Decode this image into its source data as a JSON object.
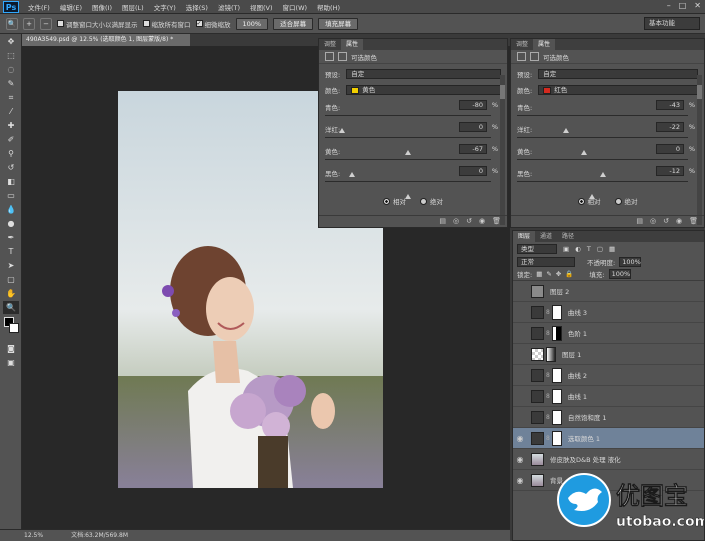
{
  "app": {
    "logo": "Ps"
  },
  "menu": [
    "文件(F)",
    "编辑(E)",
    "图像(I)",
    "图层(L)",
    "文字(Y)",
    "选择(S)",
    "滤镜(T)",
    "视图(V)",
    "窗口(W)",
    "帮助(H)"
  ],
  "window_controls": {
    "min": "–",
    "max": "□",
    "close": "✕"
  },
  "options": {
    "tool_icon": "zoom-icon",
    "resize_windows": "调整窗口大小以满屏显示",
    "zoom_all": "缩放所有窗口",
    "scrubby_zoom": "细微缩放",
    "btn_100": "100%",
    "btn_fit": "适合屏幕",
    "btn_fill": "填充屏幕",
    "workspace": "基本功能"
  },
  "document": {
    "tab": "490A3549.psd @ 12.5% (选取颜色 1, 图层蒙版/8) *",
    "zoom": "12.5%",
    "doc_size": "文档:63.2M/569.8M"
  },
  "props_left": {
    "tabs": [
      "调整",
      "属性"
    ],
    "title": "可选颜色",
    "preset_label": "预设:",
    "preset_value": "自定",
    "color_label": "颜色:",
    "color_value": "黄色",
    "swatch_color": "#f2cf00",
    "sliders": [
      {
        "label": "青色:",
        "value": "-80",
        "unit": "%",
        "pos": -80
      },
      {
        "label": "洋红:",
        "value": "0",
        "unit": "%",
        "pos": 0
      },
      {
        "label": "黄色:",
        "value": "-67",
        "unit": "%",
        "pos": -67
      },
      {
        "label": "黑色:",
        "value": "0",
        "unit": "%",
        "pos": 0
      }
    ],
    "relative": "相对",
    "absolute": "绝对"
  },
  "props_right": {
    "tabs": [
      "调整",
      "属性"
    ],
    "title": "可选颜色",
    "preset_label": "预设:",
    "preset_value": "自定",
    "color_label": "颜色:",
    "color_value": "红色",
    "swatch_color": "#d42a1f",
    "sliders": [
      {
        "label": "青色:",
        "value": "-43",
        "unit": "%",
        "pos": -43
      },
      {
        "label": "洋红:",
        "value": "-22",
        "unit": "%",
        "pos": -22
      },
      {
        "label": "黄色:",
        "value": "0",
        "unit": "%",
        "pos": 0
      },
      {
        "label": "黑色:",
        "value": "-12",
        "unit": "%",
        "pos": -12
      }
    ],
    "relative": "相对",
    "absolute": "绝对"
  },
  "layers": {
    "tabs": [
      "图层",
      "通道",
      "路径"
    ],
    "filter": "类型",
    "blend_mode": "正常",
    "opacity_label": "不透明度:",
    "opacity": "100%",
    "lock_label": "锁定:",
    "fill_label": "填充:",
    "fill": "100%",
    "rows": [
      {
        "name": "图层 2",
        "thumb": "gray"
      },
      {
        "name": "曲线 3",
        "thumb": "adjust"
      },
      {
        "name": "色阶 1",
        "thumb": "adjust"
      },
      {
        "name": "图层 1",
        "thumb": "transparent"
      },
      {
        "name": "曲线 2",
        "thumb": "adjust"
      },
      {
        "name": "曲线 1",
        "thumb": "adjust"
      },
      {
        "name": "自然饱和度 1",
        "thumb": "adjust"
      },
      {
        "name": "选取颜色 1",
        "thumb": "adjust"
      },
      {
        "name": "修皮肤及D&B 处理 液化",
        "thumb": "photo"
      },
      {
        "name": "背景",
        "thumb": "photo"
      }
    ]
  },
  "watermark": {
    "brand": "优图宝",
    "domain": "utobao.com"
  }
}
